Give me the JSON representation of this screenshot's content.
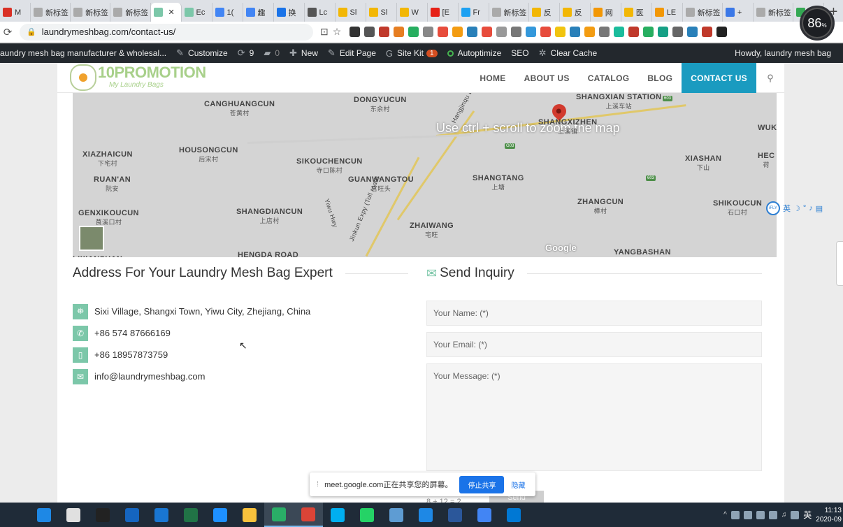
{
  "browser": {
    "tabs": [
      {
        "label": "M",
        "color": "#d93025"
      },
      {
        "label": "新标签",
        "color": "#aaaaaa"
      },
      {
        "label": "新标签",
        "color": "#aaaaaa"
      },
      {
        "label": "新标签",
        "color": "#aaaaaa"
      },
      {
        "label": "",
        "color": "#7cc7a9",
        "active": true
      },
      {
        "label": "Ec",
        "color": "#7cc7a9"
      },
      {
        "label": "1(",
        "color": "#4285f4"
      },
      {
        "label": "趣",
        "color": "#4285f4"
      },
      {
        "label": "换",
        "color": "#1a73e8"
      },
      {
        "label": "Lc",
        "color": "#555555"
      },
      {
        "label": "Sl",
        "color": "#f2b705"
      },
      {
        "label": "Sl",
        "color": "#f2b705"
      },
      {
        "label": "W",
        "color": "#f2b705"
      },
      {
        "label": "[E",
        "color": "#e62117"
      },
      {
        "label": "Fr",
        "color": "#1da1f2"
      },
      {
        "label": "新标签",
        "color": "#aaaaaa"
      },
      {
        "label": "反",
        "color": "#f2b705"
      },
      {
        "label": "反",
        "color": "#f2b705"
      },
      {
        "label": "网",
        "color": "#f29705"
      },
      {
        "label": "医",
        "color": "#f2b705"
      },
      {
        "label": "LE",
        "color": "#f29705"
      },
      {
        "label": "新标签",
        "color": "#aaaaaa"
      },
      {
        "label": "+",
        "color": "#3b78e7"
      },
      {
        "label": "新标签",
        "color": "#aaaaaa"
      },
      {
        "label": "",
        "color": "#34a853"
      }
    ],
    "url": "laundrymeshbag.com/contact-us/",
    "extension_colors": [
      "#333333",
      "#555555",
      "#c0392b",
      "#e67e22",
      "#27ae60",
      "#888888",
      "#e74c3c",
      "#f39c12",
      "#2980b9",
      "#e74c3c",
      "#999999",
      "#777777",
      "#3498db",
      "#e74c3c",
      "#f1c40f",
      "#2980b9",
      "#f39c12",
      "#777777",
      "#1abc9c",
      "#c0392b",
      "#27ae60",
      "#16a085",
      "#666666",
      "#2980b9",
      "#c0392b",
      "#222222"
    ],
    "perf_gauge": {
      "value": "86",
      "unit": "%"
    }
  },
  "wp_admin": {
    "site": "aundry mesh bag manufacturer & wholesal...",
    "customize": "Customize",
    "updates": "9",
    "comments": "0",
    "new": "New",
    "edit_page": "Edit Page",
    "site_kit": "Site Kit",
    "site_kit_badge": "1",
    "autoptimize": "Autoptimize",
    "seo": "SEO",
    "clear_cache": "Clear Cache",
    "howdy": "Howdy, laundry mesh bag"
  },
  "site": {
    "logo_brand": "10PROMOTION",
    "logo_tagline": "My Laundry Bags",
    "nav": [
      "HOME",
      "ABOUT US",
      "CATALOG",
      "BLOG",
      "CONTACT US"
    ],
    "nav_active": "CONTACT US"
  },
  "map": {
    "zoom_hint": "Use ctrl + scroll to zoom the map",
    "google": "Google",
    "labels": [
      {
        "en": "CANGHUANGCUN",
        "cn": "苍黄村"
      },
      {
        "en": "DONGYUCUN",
        "cn": "东余村"
      },
      {
        "en": "SHANGXIAN STATION",
        "cn": "上溪车站"
      },
      {
        "en": "SHANGXIZHEN",
        "cn": "上溪镇"
      },
      {
        "en": "WUK",
        "cn": ""
      },
      {
        "en": "XIAZHAICUN",
        "cn": "下宅村"
      },
      {
        "en": "HOUSONGCUN",
        "cn": "后宋村"
      },
      {
        "en": "SIKOUCHENCUN",
        "cn": "寺口陈村"
      },
      {
        "en": "GUANWANGTOU",
        "cn": "官旺头"
      },
      {
        "en": "SHANGTANG",
        "cn": "上塘"
      },
      {
        "en": "XIASHAN",
        "cn": "下山"
      },
      {
        "en": "HEC",
        "cn": "荷"
      },
      {
        "en": "RUAN'AN",
        "cn": "阮安"
      },
      {
        "en": "ZHANGCUN",
        "cn": "樟村"
      },
      {
        "en": "SHIKOUCUN",
        "cn": "石口村"
      },
      {
        "en": "GENXIKOUCUN",
        "cn": "茛溪口村"
      },
      {
        "en": "SHANGDIANCUN",
        "cn": "上店村"
      },
      {
        "en": "ZHAIWANG",
        "cn": "宅旺"
      },
      {
        "en": "YANGBASHAN",
        "cn": ""
      },
      {
        "en": "HENGDA ROAD",
        "cn": ""
      },
      {
        "en": "LIXIANSHAN",
        "cn": ""
      }
    ],
    "roads": [
      "Hangjinqu Expy (Toll road)",
      "Yiwu Hwy",
      "Jinkun Expy (Toll road)"
    ],
    "shields": [
      "603",
      "G03",
      "603"
    ]
  },
  "address": {
    "title": "Address For Your Laundry Mesh Bag Expert",
    "items": [
      {
        "icon": "map-sign-icon",
        "glyph": "⛯",
        "text": "Sixi Village, Shangxi Town, Yiwu City, Zhejiang, China"
      },
      {
        "icon": "phone-icon",
        "glyph": "✆",
        "text": "+86 574 87666169"
      },
      {
        "icon": "mobile-icon",
        "glyph": "▯",
        "text": "+86 18957873759"
      },
      {
        "icon": "envelope-icon",
        "glyph": "✉",
        "text": "info@laundrymeshbag.com"
      }
    ]
  },
  "inquiry": {
    "title": "Send Inquiry",
    "name_placeholder": "Your Name: (*)",
    "email_placeholder": "Your Email: (*)",
    "message_placeholder": "Your Message: (*)",
    "captcha": "8 + 12 =",
    "captcha_value": "2",
    "send": "Send"
  },
  "share_bar": {
    "text": "meet.google.com正在共享您的屏幕。",
    "stop": "停止共享",
    "hide": "隐藏"
  },
  "ifly": {
    "label": "iFLY",
    "lang": "英"
  },
  "taskbar": {
    "apps": [
      {
        "name": "edge",
        "color": "#1e88e5"
      },
      {
        "name": "store",
        "color": "#e0e0e0"
      },
      {
        "name": "qq",
        "color": "#222222"
      },
      {
        "name": "mail",
        "color": "#1565c0"
      },
      {
        "name": "calendar",
        "color": "#1976d2"
      },
      {
        "name": "excel",
        "color": "#217346"
      },
      {
        "name": "ie",
        "color": "#1e90ff"
      },
      {
        "name": "explorer",
        "color": "#f9c23c"
      },
      {
        "name": "wechat",
        "color": "#2aae67"
      },
      {
        "name": "chrome",
        "color": "#db4437"
      },
      {
        "name": "skype",
        "color": "#00aff0"
      },
      {
        "name": "whatsapp",
        "color": "#25d366"
      },
      {
        "name": "notes",
        "color": "#5e9cd3"
      },
      {
        "name": "browser",
        "color": "#1e88e5"
      },
      {
        "name": "word",
        "color": "#2b579a"
      },
      {
        "name": "chrome-beta",
        "color": "#4285f4"
      },
      {
        "name": "outlook",
        "color": "#0078d4"
      }
    ],
    "ime": "英",
    "time": "11:13",
    "date": "2020-09"
  }
}
